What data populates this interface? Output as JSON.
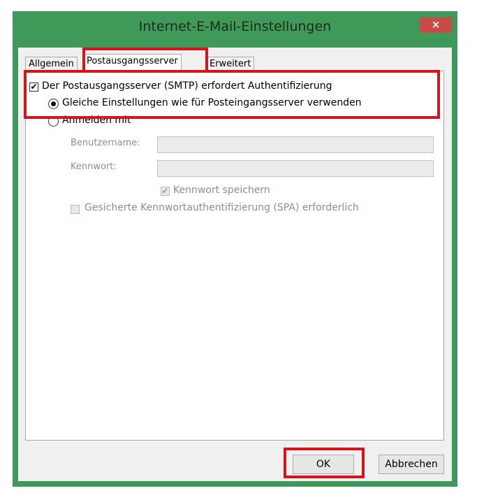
{
  "window": {
    "title": "Internet-E-Mail-Einstellungen",
    "close_label": "×"
  },
  "tabs": [
    {
      "label": "Allgemein",
      "active": false
    },
    {
      "label": "Postausgangsserver",
      "active": true
    },
    {
      "label": "Erweitert",
      "active": false
    }
  ],
  "smtp_auth": {
    "label": "Der Postausgangsserver (SMTP) erfordert Authentifizierung",
    "checked": true,
    "check_mark": "✔"
  },
  "radio_same": {
    "label": "Gleiche Einstellungen wie für Posteingangsserver verwenden",
    "selected": true
  },
  "radio_login": {
    "label": "Anmelden mit",
    "selected": false
  },
  "username": {
    "label": "Benutzername:",
    "value": ""
  },
  "password": {
    "label": "Kennwort:",
    "value": ""
  },
  "remember_password": {
    "label": "Kennwort speichern",
    "checked": true,
    "check_mark": "✔"
  },
  "spa": {
    "label": "Gesicherte Kennwortauthentifizierung (SPA) erforderlich",
    "checked": false
  },
  "buttons": {
    "ok": "OK",
    "cancel": "Abbrechen"
  },
  "colors": {
    "frame": "#3f9a5a",
    "highlight": "#d4141e",
    "close": "#c84b45"
  }
}
